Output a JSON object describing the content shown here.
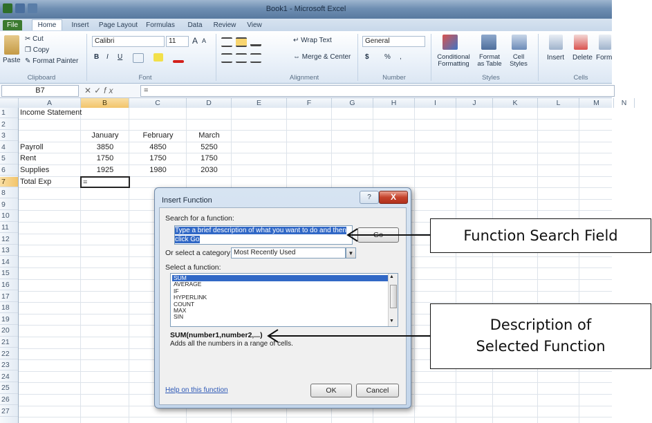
{
  "window": {
    "title": "Book1 - Microsoft Excel"
  },
  "tabs": [
    "File",
    "Home",
    "Insert",
    "Page Layout",
    "Formulas",
    "Data",
    "Review",
    "View"
  ],
  "ribbon": {
    "clipboard": {
      "paste": "Paste",
      "cut": "Cut",
      "copy": "Copy",
      "format_painter": "Format Painter",
      "label": "Clipboard"
    },
    "font": {
      "name": "Calibri",
      "size": "11",
      "grow": "A",
      "shrink": "A",
      "bold": "B",
      "italic": "I",
      "underline": "U",
      "label": "Font"
    },
    "alignment": {
      "wrap": "Wrap Text",
      "merge": "Merge & Center",
      "label": "Alignment"
    },
    "number": {
      "format": "General",
      "currency": "$",
      "percent": "%",
      "comma": ",",
      "label": "Number"
    },
    "styles": {
      "conditional": "Conditional Formatting",
      "format_table": "Format as Table",
      "cell_styles": "Cell Styles",
      "label": "Styles"
    },
    "cells": {
      "insert": "Insert",
      "delete": "Delete",
      "format": "Format",
      "label": "Cells"
    }
  },
  "formula_bar": {
    "name_box": "B7",
    "controls": "✕✓",
    "fx": "fx",
    "content": "="
  },
  "columns": [
    "A",
    "B",
    "C",
    "D",
    "E",
    "F",
    "G",
    "H",
    "I",
    "J",
    "K",
    "L",
    "M",
    "N"
  ],
  "selected_column": "B",
  "rows": [
    "1",
    "2",
    "3",
    "4",
    "5",
    "6",
    "7",
    "8",
    "9",
    "10",
    "11",
    "12",
    "13",
    "14",
    "15",
    "16",
    "17",
    "18",
    "19",
    "20",
    "21",
    "22",
    "23",
    "24",
    "25",
    "26",
    "27"
  ],
  "selected_row": "7",
  "sheet": {
    "title": "Income Statement",
    "months": [
      "January",
      "February",
      "March"
    ],
    "records": [
      {
        "label": "Payroll",
        "values": [
          "3850",
          "4850",
          "5250"
        ]
      },
      {
        "label": "Rent",
        "values": [
          "1750",
          "1750",
          "1750"
        ]
      },
      {
        "label": "Supplies",
        "values": [
          "1925",
          "1980",
          "2030"
        ]
      }
    ],
    "total_label": "Total Exp",
    "active_cell_value": "="
  },
  "dialog": {
    "title": "Insert Function",
    "help": "?",
    "close": "X",
    "search_label": "Search for a function:",
    "search_value": "Type a brief description of what you want to do and then click Go",
    "go_button": "Go",
    "category_label": "Or select a category:",
    "category_value": "Most Recently Used",
    "select_label": "Select a function:",
    "functions": [
      "SUM",
      "AVERAGE",
      "IF",
      "HYPERLINK",
      "COUNT",
      "MAX",
      "SIN"
    ],
    "selected_function": "SUM",
    "signature": "SUM(number1,number2,...)",
    "description": "Adds all the numbers in a range of cells.",
    "help_link": "Help on this function",
    "ok": "OK",
    "cancel": "Cancel"
  },
  "callouts": {
    "search_field": "Function Search Field",
    "description_line1": "Description of",
    "description_line2": "Selected Function"
  },
  "colors": {
    "selection_blue": "#3168c6",
    "header_highlight": "#f2c46b",
    "close_red": "#c5432c",
    "file_tab_green": "#3b7a2f"
  }
}
